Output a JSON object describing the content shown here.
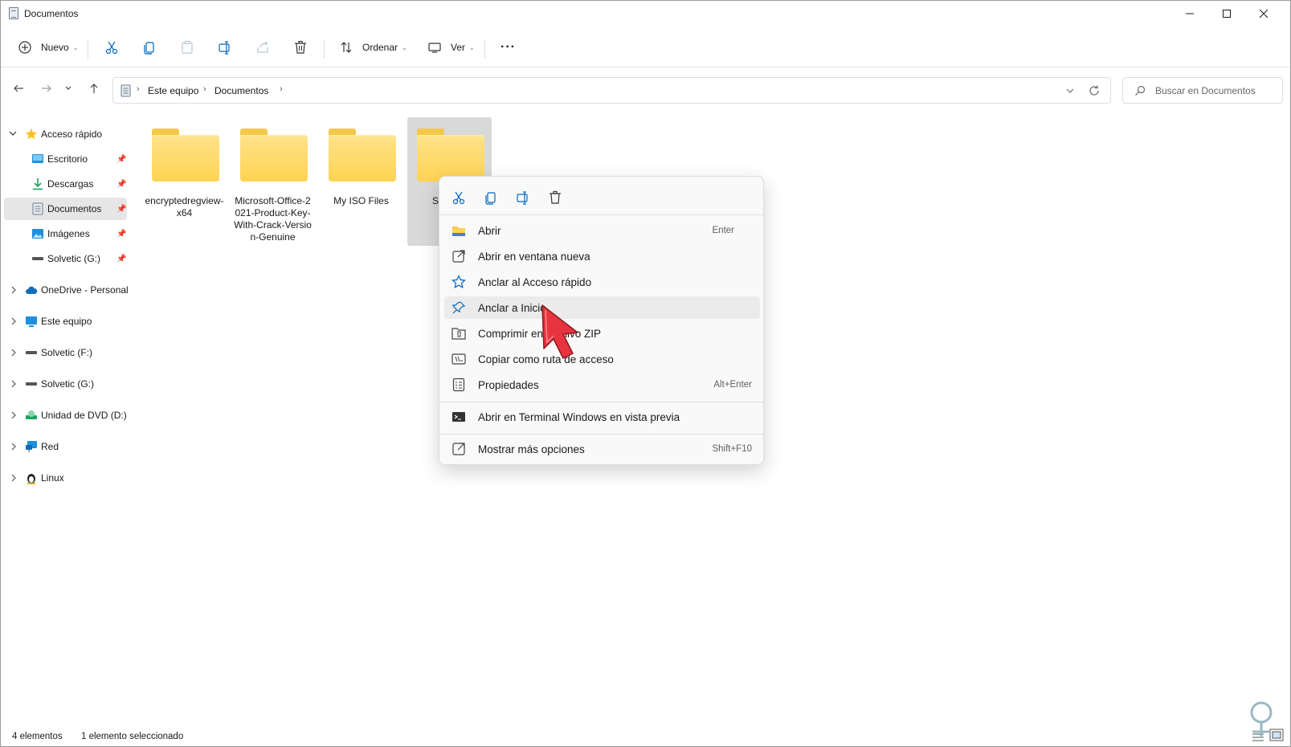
{
  "window": {
    "title": "Documentos"
  },
  "title_controls": {
    "minimize": "—",
    "maximize": "☐",
    "close": "✕"
  },
  "toolbar": {
    "new_label": "Nuevo",
    "sort_label": "Ordenar",
    "view_label": "Ver",
    "more_label": "···"
  },
  "address": {
    "crumbs": [
      "Este equipo",
      "Documentos"
    ]
  },
  "search": {
    "placeholder": "Buscar en Documentos"
  },
  "sidebar": {
    "quick_access": "Acceso rápido",
    "quick_items": [
      "Escritorio",
      "Descargas",
      "Documentos",
      "Imágenes",
      "Solvetic (G:)"
    ],
    "sections": [
      "OneDrive - Personal",
      "Este equipo",
      "Solvetic (F:)",
      "Solvetic (G:)",
      "Unidad de DVD (D:)",
      "Red",
      "Linux"
    ]
  },
  "folders": [
    {
      "name": "encryptedregview-x64"
    },
    {
      "name": "Microsoft-Office-2021-Product-Key-With-Crack-Version-Genuine"
    },
    {
      "name": "My ISO Files"
    },
    {
      "name": "S"
    }
  ],
  "context_menu": {
    "items": [
      {
        "label": "Abrir",
        "shortcut": "Enter",
        "icon": "folder-open-icon"
      },
      {
        "label": "Abrir en ventana nueva",
        "shortcut": "",
        "icon": "open-new-window-icon"
      },
      {
        "label": "Anclar al Acceso rápido",
        "shortcut": "",
        "icon": "star-icon"
      },
      {
        "label": "Anclar a Inicio",
        "shortcut": "",
        "icon": "pin-icon"
      },
      {
        "label": "Comprimir en archivo ZIP",
        "shortcut": "",
        "icon": "zip-icon"
      },
      {
        "label": "Copiar como ruta de acceso",
        "shortcut": "",
        "icon": "copy-path-icon"
      },
      {
        "label": "Propiedades",
        "shortcut": "Alt+Enter",
        "icon": "properties-icon"
      },
      {
        "label": "Abrir en Terminal Windows en vista previa",
        "shortcut": "",
        "icon": "terminal-icon"
      },
      {
        "label": "Mostrar más opciones",
        "shortcut": "Shift+F10",
        "icon": "more-options-icon"
      }
    ]
  },
  "status": {
    "count": "4 elementos",
    "selection": "1 elemento seleccionado"
  },
  "colors": {
    "folder": "#ffd352",
    "accent": "#0067c0",
    "cursor": "#e8343e"
  }
}
